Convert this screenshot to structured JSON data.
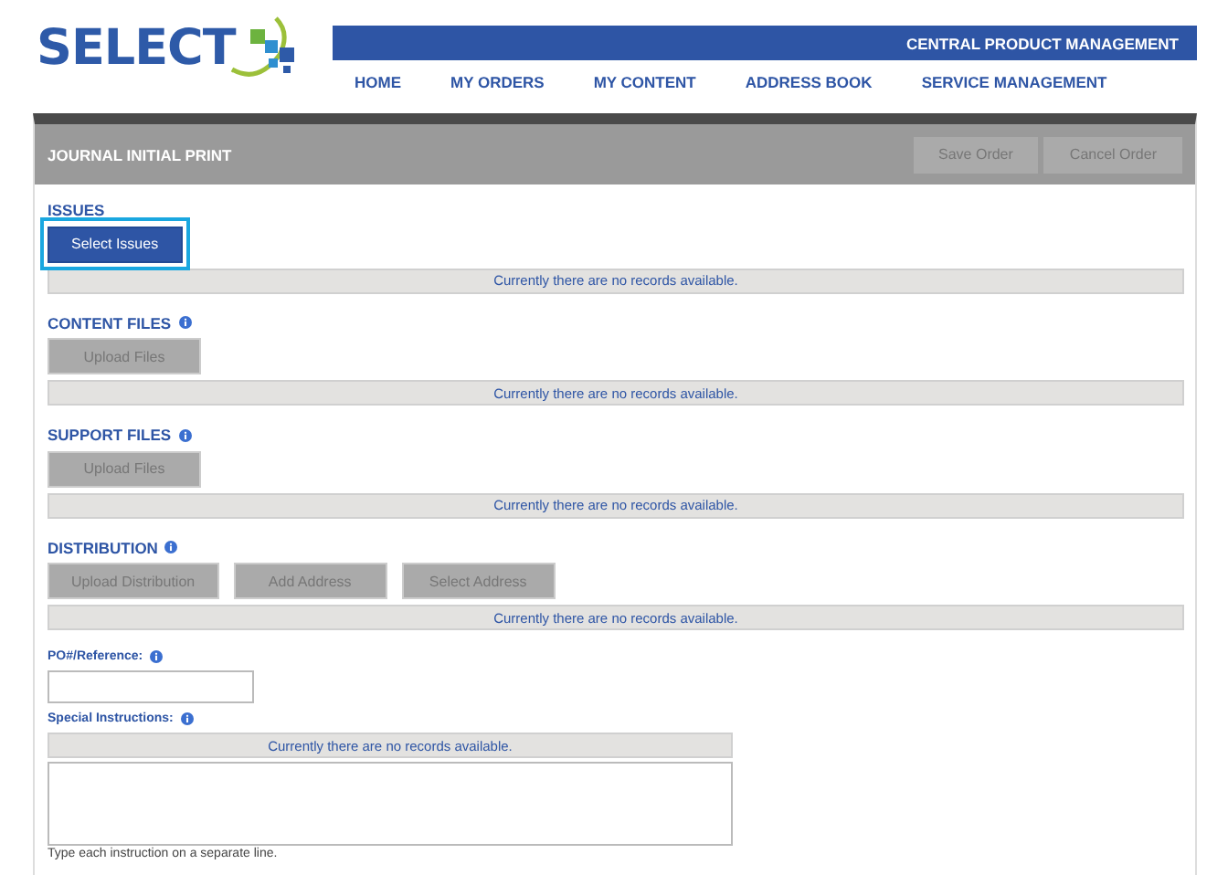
{
  "logo": {
    "text": "SELECT"
  },
  "banner": {
    "title": "CENTRAL PRODUCT MANAGEMENT"
  },
  "nav": [
    {
      "label": "HOME"
    },
    {
      "label": "MY ORDERS"
    },
    {
      "label": "MY CONTENT"
    },
    {
      "label": "ADDRESS BOOK"
    },
    {
      "label": "SERVICE MANAGEMENT"
    }
  ],
  "panel": {
    "title": "JOURNAL INITIAL PRINT",
    "actions": [
      {
        "label": "Save Order",
        "disabled": true
      },
      {
        "label": "Cancel Order",
        "disabled": true
      }
    ]
  },
  "sections": [
    {
      "title": "ISSUES",
      "info": false,
      "buttons": [
        {
          "label": "Select Issues",
          "disabled": false,
          "highlighted": true
        }
      ],
      "empty_message": "Currently there are no records available."
    },
    {
      "title": "CONTENT FILES",
      "info": true,
      "buttons": [
        {
          "label": "Upload Files",
          "disabled": true,
          "highlighted": false
        }
      ],
      "empty_message": "Currently there are no records available."
    },
    {
      "title": "SUPPORT FILES",
      "info": true,
      "buttons": [
        {
          "label": "Upload Files",
          "disabled": true,
          "highlighted": false
        }
      ],
      "empty_message": "Currently there are no records available."
    },
    {
      "title": "DISTRIBUTION",
      "info": true,
      "buttons": [
        {
          "label": "Upload Distribution",
          "disabled": true,
          "highlighted": false
        },
        {
          "label": "Add Address",
          "disabled": true,
          "highlighted": false
        },
        {
          "label": "Select Address",
          "disabled": true,
          "highlighted": false
        }
      ],
      "empty_message": "Currently there are no records available."
    }
  ],
  "po_reference": {
    "label": "PO#/Reference:",
    "info": true
  },
  "special_instructions": {
    "label": "Special Instructions:",
    "info": true,
    "empty_message": "Currently there are no records available.",
    "hint": "Type each instruction on a separate line."
  }
}
